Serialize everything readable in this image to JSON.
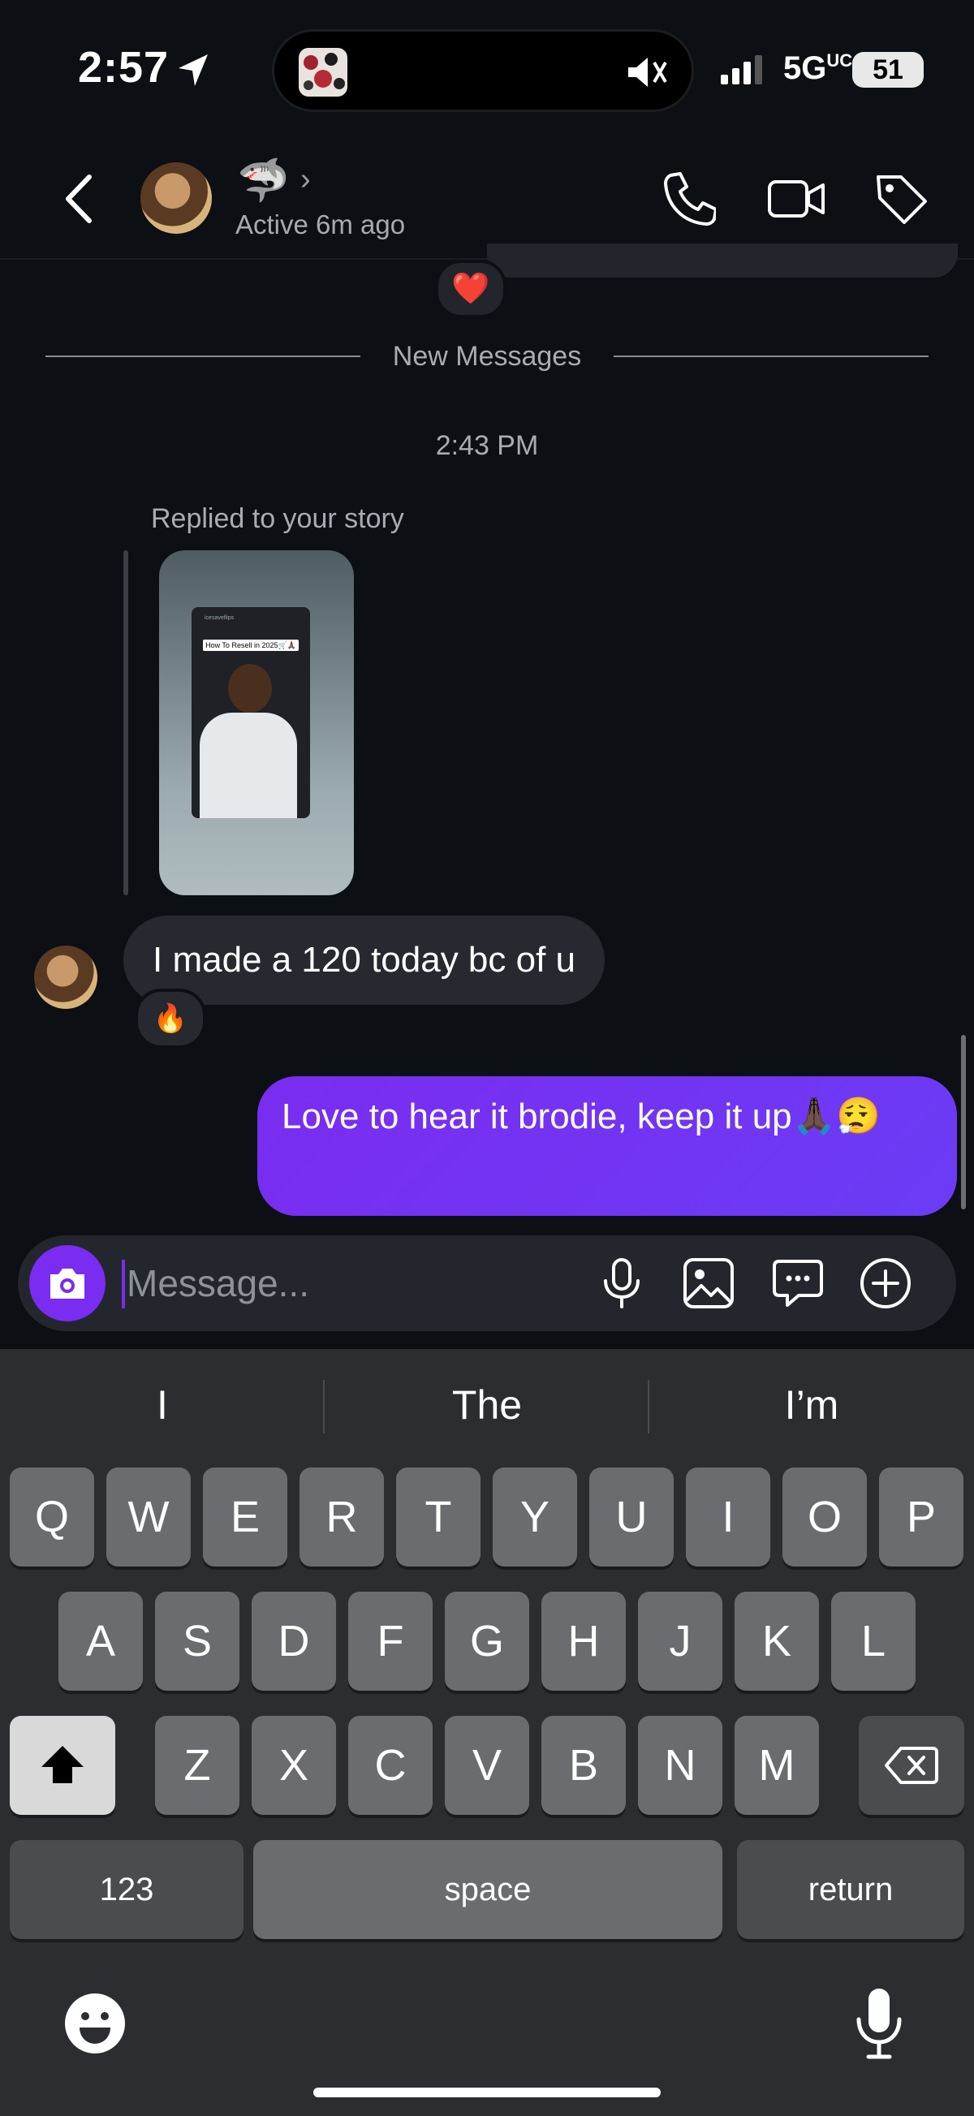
{
  "status_bar": {
    "time": "2:57",
    "network": "5G",
    "battery": "51"
  },
  "header": {
    "contact_emoji": "🦈",
    "active_status": "Active 6m ago"
  },
  "chat": {
    "previous_reaction": "❤️",
    "new_messages_label": "New Messages",
    "timestamp": "2:43 PM",
    "replied_label": "Replied to your story",
    "story": {
      "top_text": "icesaveflips",
      "overlay_text": "How To Resell in 2025🛒🙏🏾"
    },
    "incoming_message": "I made a 120 today bc of u",
    "incoming_reaction": "🔥",
    "outgoing_message": "Love to hear it brodie, keep it up🙏🏿😮‍💨"
  },
  "composer": {
    "placeholder": "Message..."
  },
  "keyboard": {
    "suggestions": [
      "I",
      "The",
      "I’m"
    ],
    "row1": [
      "Q",
      "W",
      "E",
      "R",
      "T",
      "Y",
      "U",
      "I",
      "O",
      "P"
    ],
    "row2": [
      "A",
      "S",
      "D",
      "F",
      "G",
      "H",
      "J",
      "K",
      "L"
    ],
    "row3": [
      "Z",
      "X",
      "C",
      "V",
      "B",
      "N",
      "M"
    ],
    "numbers_label": "123",
    "space_label": "space",
    "return_label": "return"
  },
  "colors": {
    "background": "#0c0f14",
    "accent": "#7a2cf0",
    "bubble_in": "#26292f",
    "keyboard": "#2b2d30"
  }
}
